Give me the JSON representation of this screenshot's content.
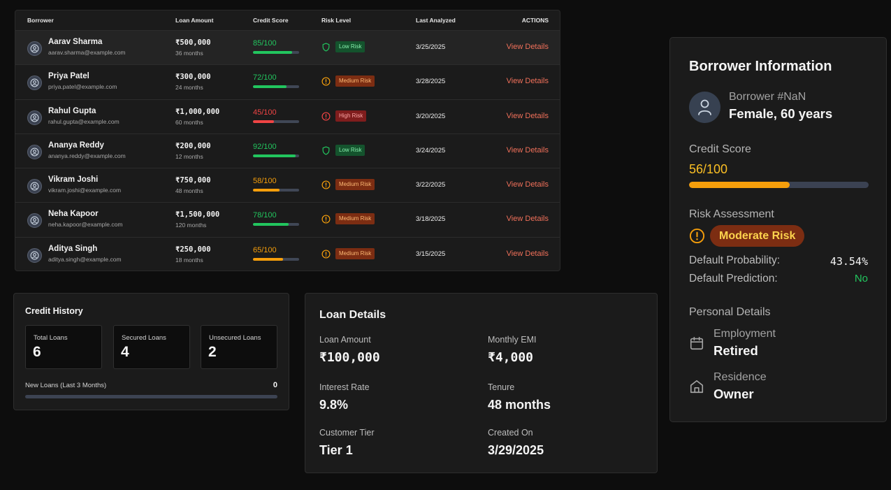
{
  "table": {
    "headers": {
      "borrower": "Borrower",
      "loan_amount": "Loan Amount",
      "credit_score": "Credit Score",
      "risk_level": "Risk Level",
      "last_analyzed": "Last Analyzed",
      "actions": "ACTIONS"
    },
    "rows": [
      {
        "name": "Aarav Sharma",
        "email": "aarav.sharma@example.com",
        "amount": "₹500,000",
        "term": "36 months",
        "score": "85/100",
        "score_pct": 85,
        "score_color": "green",
        "risk": "Low Risk",
        "risk_level": "low",
        "date": "3/25/2025",
        "action": "View Details"
      },
      {
        "name": "Priya Patel",
        "email": "priya.patel@example.com",
        "amount": "₹300,000",
        "term": "24 months",
        "score": "72/100",
        "score_pct": 72,
        "score_color": "green",
        "risk": "Medium Risk",
        "risk_level": "medium",
        "date": "3/28/2025",
        "action": "View Details"
      },
      {
        "name": "Rahul Gupta",
        "email": "rahul.gupta@example.com",
        "amount": "₹1,000,000",
        "term": "60 months",
        "score": "45/100",
        "score_pct": 45,
        "score_color": "red",
        "risk": "High Risk",
        "risk_level": "high",
        "date": "3/20/2025",
        "action": "View Details"
      },
      {
        "name": "Ananya Reddy",
        "email": "ananya.reddy@example.com",
        "amount": "₹200,000",
        "term": "12 months",
        "score": "92/100",
        "score_pct": 92,
        "score_color": "green",
        "risk": "Low Risk",
        "risk_level": "low",
        "date": "3/24/2025",
        "action": "View Details"
      },
      {
        "name": "Vikram Joshi",
        "email": "vikram.joshi@example.com",
        "amount": "₹750,000",
        "term": "48 months",
        "score": "58/100",
        "score_pct": 58,
        "score_color": "amber",
        "risk": "Medium Risk",
        "risk_level": "medium",
        "date": "3/22/2025",
        "action": "View Details"
      },
      {
        "name": "Neha Kapoor",
        "email": "neha.kapoor@example.com",
        "amount": "₹1,500,000",
        "term": "120 months",
        "score": "78/100",
        "score_pct": 78,
        "score_color": "green",
        "risk": "Medium Risk",
        "risk_level": "medium",
        "date": "3/18/2025",
        "action": "View Details"
      },
      {
        "name": "Aditya Singh",
        "email": "aditya.singh@example.com",
        "amount": "₹250,000",
        "term": "18 months",
        "score": "65/100",
        "score_pct": 65,
        "score_color": "amber",
        "risk": "Medium Risk",
        "risk_level": "medium",
        "date": "3/15/2025",
        "action": "View Details"
      }
    ]
  },
  "credit_history": {
    "title": "Credit History",
    "stats": [
      {
        "label": "Total Loans",
        "value": "6"
      },
      {
        "label": "Secured Loans",
        "value": "4"
      },
      {
        "label": "Unsecured Loans",
        "value": "2"
      }
    ],
    "new_loans_label": "New Loans (Last 3 Months)",
    "new_loans_value": "0",
    "new_loans_pct": 0
  },
  "loan_details": {
    "title": "Loan Details",
    "fields": [
      {
        "label": "Loan Amount",
        "value": "₹100,000"
      },
      {
        "label": "Monthly EMI",
        "value": "₹4,000"
      },
      {
        "label": "Interest Rate",
        "value": "9.8%"
      },
      {
        "label": "Tenure",
        "value": "48 months"
      },
      {
        "label": "Customer Tier",
        "value": "Tier 1"
      },
      {
        "label": "Created On",
        "value": "3/29/2025"
      }
    ]
  },
  "borrower_info": {
    "title": "Borrower Information",
    "borrower_number": "Borrower #NaN",
    "demographics": "Female, 60 years",
    "credit_score_label": "Credit Score",
    "credit_score": "56/100",
    "credit_score_pct": 56,
    "risk_assessment_label": "Risk Assessment",
    "risk_badge": "Moderate Risk",
    "default_probability_label": "Default Probability:",
    "default_probability": "43.54%",
    "default_prediction_label": "Default Prediction:",
    "default_prediction": "No",
    "personal_details_label": "Personal Details",
    "employment_label": "Employment",
    "employment": "Retired",
    "residence_label": "Residence",
    "residence": "Owner"
  },
  "colors": {
    "green": "#22c55e",
    "amber": "#f59e0b",
    "red": "#ef4444",
    "link": "#f0705a"
  },
  "icons": {
    "low": "shield-icon",
    "medium": "alert-circle-icon",
    "high": "alert-circle-icon"
  }
}
